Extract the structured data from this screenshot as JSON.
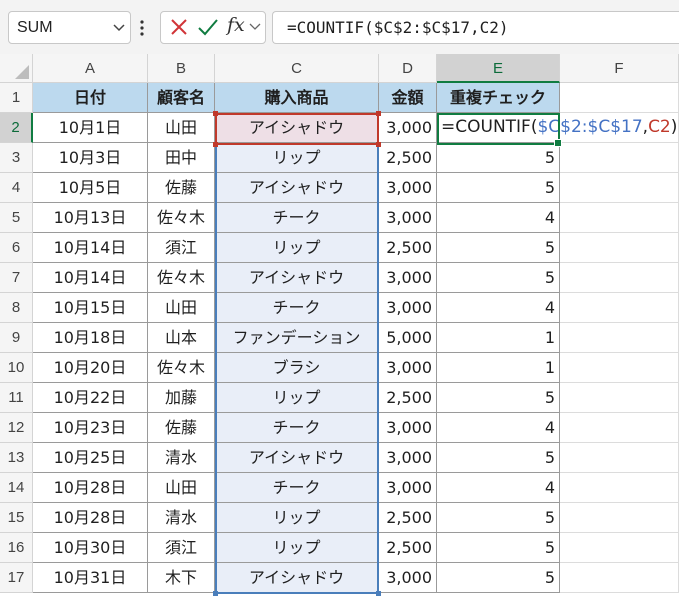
{
  "name_box": {
    "value": "SUM"
  },
  "formula_bar": {
    "formula": "=COUNTIF($C$2:$C$17,C2)",
    "icons": [
      "chevron-down-icon",
      "more-options-icon",
      "cancel-icon",
      "enter-check-icon",
      "insert-function-icon"
    ],
    "fx_label": "fx"
  },
  "colors": {
    "accent": "#107c41",
    "header_fill": "#bcd9ee",
    "range_blue": "#4a7ebb",
    "ref_red": "#c0392b"
  },
  "columns": [
    "A",
    "B",
    "C",
    "D",
    "E",
    "F"
  ],
  "rows": [
    "1",
    "2",
    "3",
    "4",
    "5",
    "6",
    "7",
    "8",
    "9",
    "10",
    "11",
    "12",
    "13",
    "14",
    "15",
    "16",
    "17"
  ],
  "table": {
    "headers": [
      "日付",
      "顧客名",
      "購入商品",
      "金額",
      "重複チェック"
    ],
    "data": [
      [
        "10月1日",
        "山田",
        "アイシャドウ",
        "3,000",
        ""
      ],
      [
        "10月3日",
        "田中",
        "リップ",
        "2,500",
        "5"
      ],
      [
        "10月5日",
        "佐藤",
        "アイシャドウ",
        "3,000",
        "5"
      ],
      [
        "10月13日",
        "佐々木",
        "チーク",
        "3,000",
        "4"
      ],
      [
        "10月14日",
        "須江",
        "リップ",
        "2,500",
        "5"
      ],
      [
        "10月14日",
        "佐々木",
        "アイシャドウ",
        "3,000",
        "5"
      ],
      [
        "10月15日",
        "山田",
        "チーク",
        "3,000",
        "4"
      ],
      [
        "10月18日",
        "山本",
        "ファンデーション",
        "5,000",
        "1"
      ],
      [
        "10月20日",
        "佐々木",
        "ブラシ",
        "3,000",
        "1"
      ],
      [
        "10月22日",
        "加藤",
        "リップ",
        "2,500",
        "5"
      ],
      [
        "10月23日",
        "佐藤",
        "チーク",
        "3,000",
        "4"
      ],
      [
        "10月25日",
        "清水",
        "アイシャドウ",
        "3,000",
        "5"
      ],
      [
        "10月28日",
        "山田",
        "チーク",
        "3,000",
        "4"
      ],
      [
        "10月28日",
        "清水",
        "リップ",
        "2,500",
        "5"
      ],
      [
        "10月30日",
        "須江",
        "リップ",
        "2,500",
        "5"
      ],
      [
        "10月31日",
        "木下",
        "アイシャドウ",
        "3,000",
        "5"
      ]
    ]
  },
  "editing_cell": {
    "prefix": "=COUNTIF(",
    "range_ref": "$C$2:$C$17",
    "comma": ",",
    "cell_ref": "C2",
    "suffix": ")"
  }
}
